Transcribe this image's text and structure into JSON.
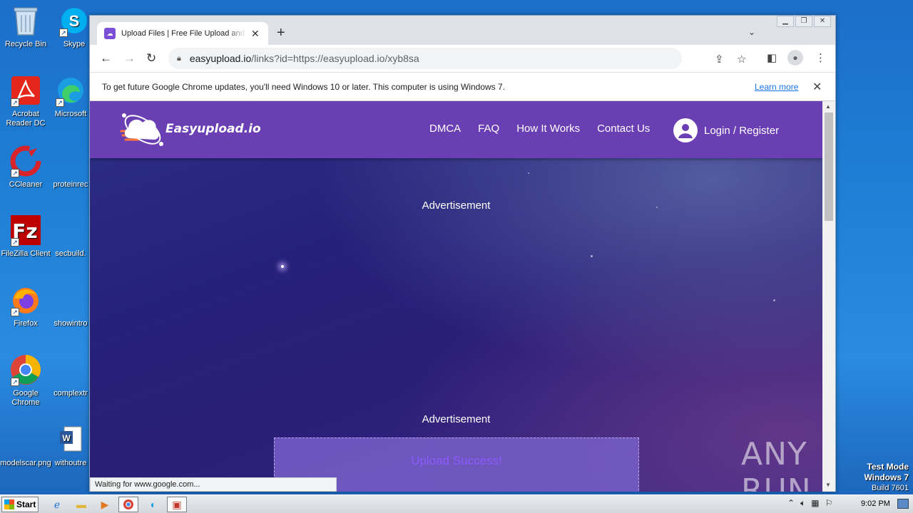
{
  "desktop": {
    "icons": [
      {
        "label": "Recycle Bin",
        "icon": "recycle-bin-icon"
      },
      {
        "label": "Skype",
        "icon": "skype-icon"
      },
      {
        "label": "Acrobat Reader DC",
        "icon": "acrobat-icon"
      },
      {
        "label": "Microsoft",
        "icon": "edge-icon"
      },
      {
        "label": "CCleaner",
        "icon": "ccleaner-icon"
      },
      {
        "label": "proteinrec",
        "icon": "file-icon"
      },
      {
        "label": "FileZilla Client",
        "icon": "filezilla-icon"
      },
      {
        "label": "secbuild.",
        "icon": "file-icon"
      },
      {
        "label": "Firefox",
        "icon": "firefox-icon"
      },
      {
        "label": "showintro",
        "icon": "file-icon"
      },
      {
        "label": "Google Chrome",
        "icon": "chrome-icon"
      },
      {
        "label": "complextr",
        "icon": "file-icon"
      },
      {
        "label": "modelscar.png",
        "icon": "image-file-icon"
      },
      {
        "label": "withoutre",
        "icon": "word-icon"
      }
    ]
  },
  "browser": {
    "tab_title": "Upload Files | Free File Upload and Transfer",
    "url_host": "easyupload.io",
    "url_path": "/links?id=https://easyupload.io/xyb8sa",
    "infobar_text": "To get future Google Chrome updates, you'll need Windows 10 or later. This computer is using Windows 7.",
    "infobar_link": "Learn more",
    "status_text": "Waiting for www.google.com..."
  },
  "site": {
    "logo_text": "Easyupload.io",
    "nav": [
      "DMCA",
      "FAQ",
      "How It Works",
      "Contact Us"
    ],
    "login_label": "Login / Register",
    "ad_label_1": "Advertisement",
    "ad_label_2": "Advertisement",
    "upload_title": "Upload Success!",
    "colors": {
      "header": "#6a3fb3",
      "upload_title": "#8c5bff"
    }
  },
  "watermark": "ANY RUN",
  "system": {
    "start_label": "Start",
    "clock": "9:02 PM",
    "test_mode_line1": "Test Mode",
    "test_mode_line2": "Windows 7",
    "test_mode_line3": "Build 7601"
  }
}
